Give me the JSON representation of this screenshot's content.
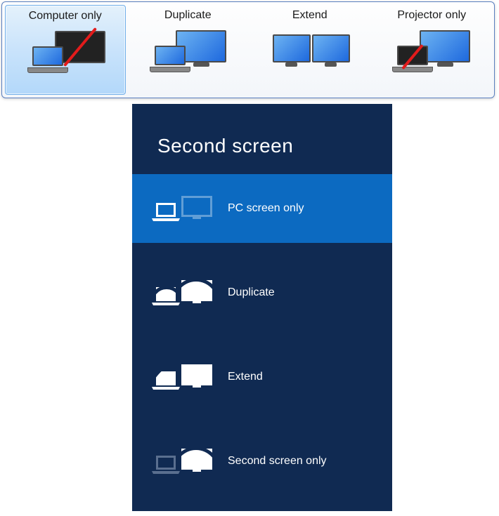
{
  "win7_popup": {
    "options": [
      {
        "label": "Computer only",
        "selected": true
      },
      {
        "label": "Duplicate",
        "selected": false
      },
      {
        "label": "Extend",
        "selected": false
      },
      {
        "label": "Projector only",
        "selected": false
      }
    ]
  },
  "win8_panel": {
    "title": "Second screen",
    "items": [
      {
        "label": "PC screen only",
        "selected": true
      },
      {
        "label": "Duplicate",
        "selected": false
      },
      {
        "label": "Extend",
        "selected": false
      },
      {
        "label": "Second screen only",
        "selected": false
      }
    ]
  }
}
